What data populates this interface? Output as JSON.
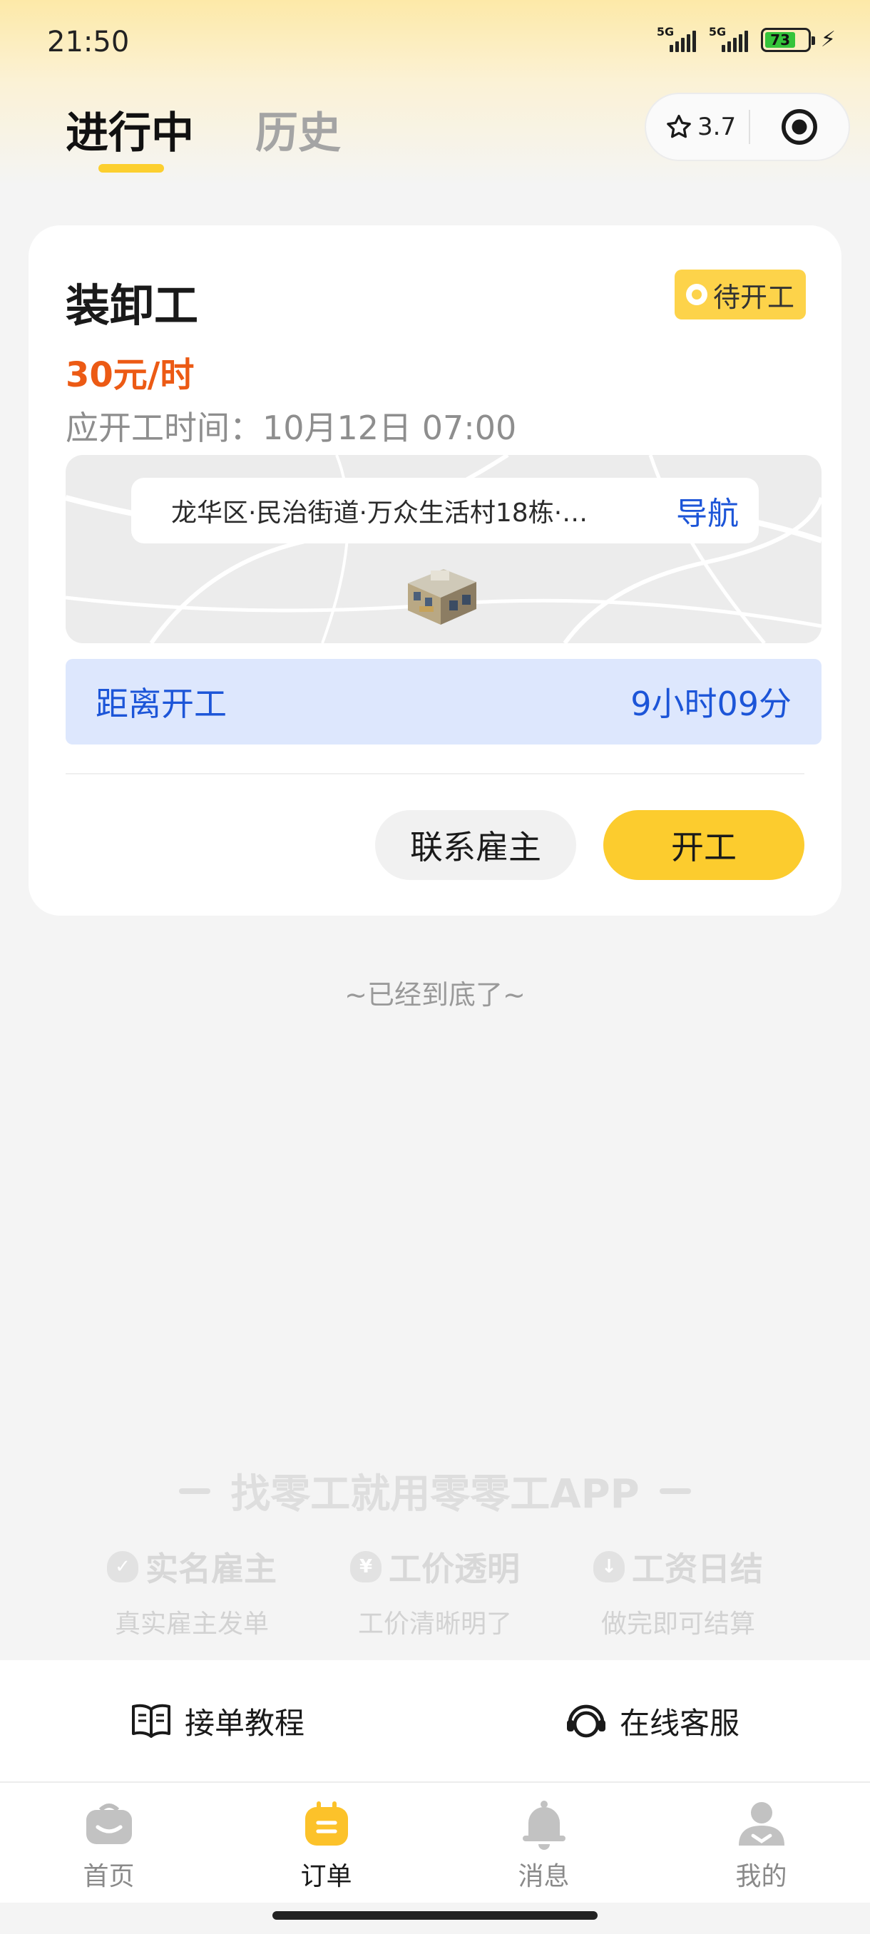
{
  "status_bar": {
    "time": "21:50",
    "net1": "5G",
    "net2": "5G",
    "battery": "73"
  },
  "tabs": [
    {
      "label": "进行中"
    },
    {
      "label": "历史"
    }
  ],
  "rating": {
    "value": "3.7"
  },
  "order": {
    "title": "装卸工",
    "status": "待开工",
    "wage": "30元/时",
    "start_time": "应开工时间：10月12日 07:00",
    "address": "龙华区·民治街道·万众生活村18栋·…",
    "navigate": "导航",
    "countdown_label": "距离开工",
    "countdown_value": "9小时09分",
    "contact_button": "联系雇主",
    "start_button": "开工"
  },
  "end_of_list": "~已经到底了~",
  "promo": {
    "title": "找零工就用零零工APP",
    "features": [
      {
        "title": "实名雇主",
        "sub": "真实雇主发单"
      },
      {
        "title": "工价透明",
        "sub": "工价清晰明了"
      },
      {
        "title": "工资日结",
        "sub": "做完即可结算"
      }
    ]
  },
  "help": {
    "tutorial": "接单教程",
    "service": "在线客服"
  },
  "tabbar": [
    {
      "label": "首页"
    },
    {
      "label": "订单"
    },
    {
      "label": "消息"
    },
    {
      "label": "我的"
    }
  ],
  "colors": {
    "accent": "#fccc2e",
    "wage": "#ec5a14",
    "link": "#1c55d8",
    "countdown_bg": "#dde7fd"
  }
}
